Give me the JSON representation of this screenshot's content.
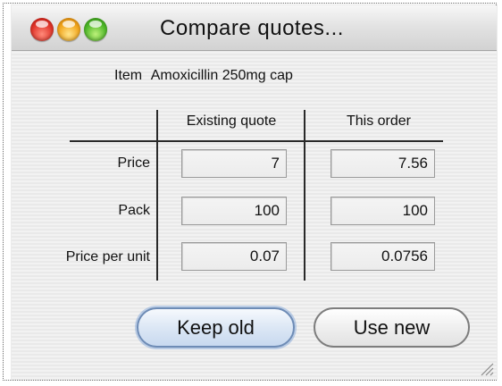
{
  "window": {
    "title": "Compare quotes..."
  },
  "item": {
    "label": "Item",
    "value": "Amoxicillin 250mg cap"
  },
  "columns": [
    "Existing quote",
    "This order"
  ],
  "rows": [
    {
      "label": "Price",
      "existing": "7",
      "order": "7.56"
    },
    {
      "label": "Pack",
      "existing": "100",
      "order": "100"
    },
    {
      "label": "Price per unit",
      "existing": "0.07",
      "order": "0.0756"
    }
  ],
  "buttons": {
    "keep_old": "Keep old",
    "use_new": "Use new"
  },
  "colors": {
    "close": "#e0352a",
    "minimize": "#f2a51c",
    "zoom": "#4fb829",
    "default_button": "#c8d9ef"
  },
  "icons": [
    "close-icon",
    "minimize-icon",
    "zoom-icon",
    "resize-grip-icon"
  ]
}
